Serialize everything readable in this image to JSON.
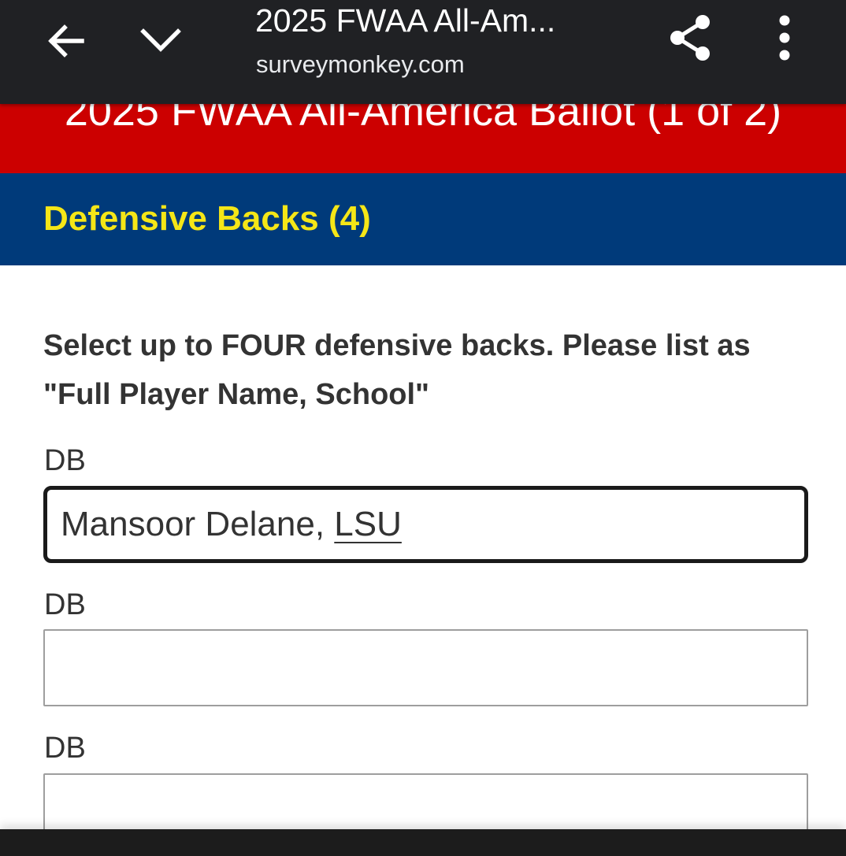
{
  "browser": {
    "title": "2025 FWAA All-Am...",
    "url": "surveymonkey.com",
    "icons": {
      "back": "arrow-left-icon",
      "collapse": "chevron-down-icon",
      "share": "share-icon",
      "menu": "more-vert-icon"
    }
  },
  "survey": {
    "title": "2025 FWAA All-America Ballot (1 of 2)",
    "section_title": "Defensive Backs (4)",
    "question": "Select up to FOUR defensive backs. Please list as \"Full Player Name, School\"",
    "fields": [
      {
        "label": "DB",
        "value_name": "Mansoor Delane, ",
        "value_school": "LSU",
        "state": "focused"
      },
      {
        "label": "DB",
        "value": ""
      },
      {
        "label": "DB",
        "value": ""
      }
    ]
  },
  "colors": {
    "browser_bar": "#202124",
    "header_red": "#cc0000",
    "section_blue": "#003a7a",
    "section_text": "#f5e617",
    "body_text": "#333333"
  }
}
